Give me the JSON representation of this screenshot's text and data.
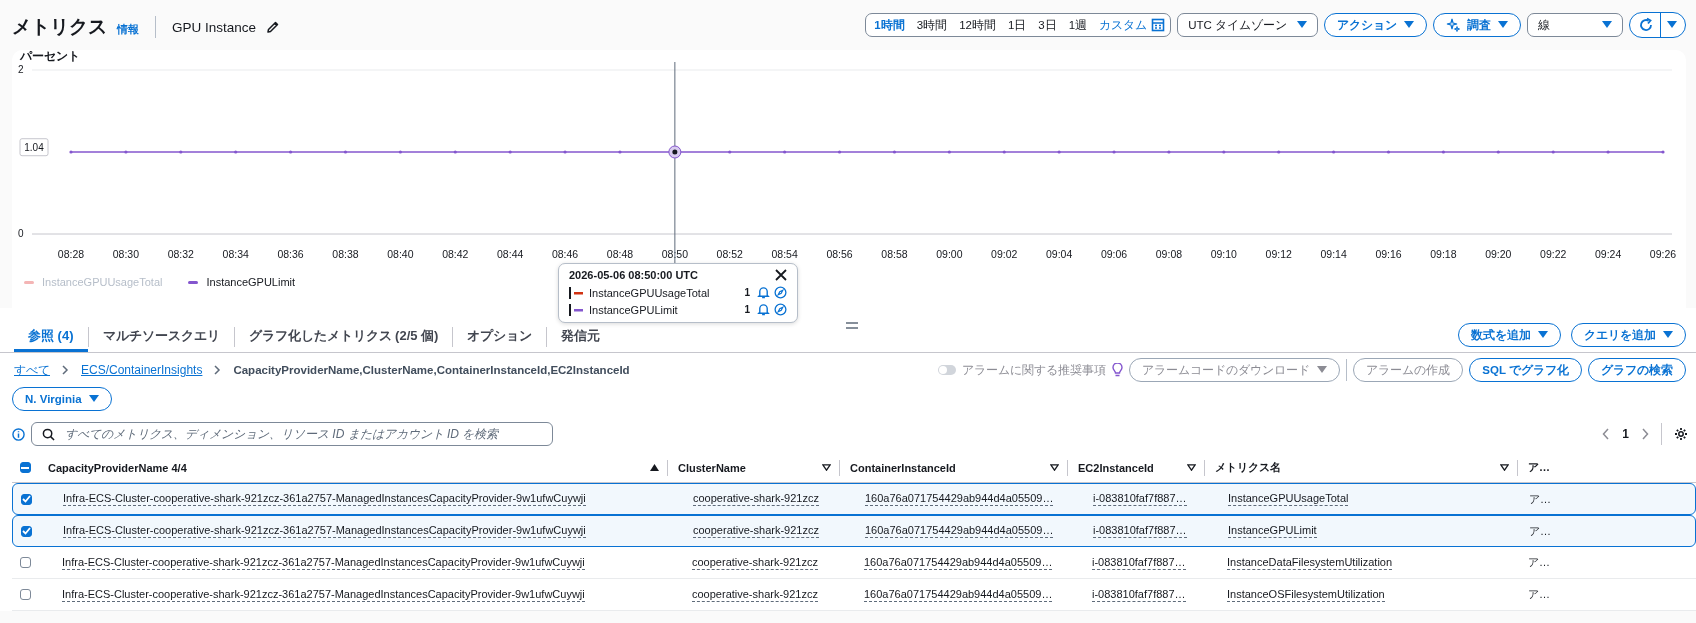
{
  "header": {
    "title": "メトリクス",
    "info_link": "情報",
    "graph_name": "GPU Instance"
  },
  "time_range": {
    "options": [
      {
        "label": "1時間",
        "selected": true
      },
      {
        "label": "3時間",
        "selected": false
      },
      {
        "label": "12時間",
        "selected": false
      },
      {
        "label": "1日",
        "selected": false
      },
      {
        "label": "3日",
        "selected": false
      },
      {
        "label": "1週",
        "selected": false
      }
    ],
    "custom": "カスタム"
  },
  "timezone": "UTC タイムゾーン",
  "actions": "アクション",
  "investigate": "調査",
  "chart_style": "線",
  "chart": {
    "ylabel": "パーセント",
    "cursor_value": "1.04",
    "chart_data": {
      "type": "line",
      "ylim": [
        0,
        2
      ],
      "yticks": [
        0,
        2
      ],
      "categories": [
        "08:28",
        "08:30",
        "08:32",
        "08:34",
        "08:36",
        "08:38",
        "08:40",
        "08:42",
        "08:44",
        "08:46",
        "08:48",
        "08:50",
        "08:52",
        "08:54",
        "08:56",
        "08:58",
        "09:00",
        "09:02",
        "09:04",
        "09:06",
        "09:08",
        "09:10",
        "09:12",
        "09:14",
        "09:16",
        "09:18",
        "09:20",
        "09:22",
        "09:24",
        "09:26"
      ],
      "series": [
        {
          "name": "InstanceGPULimit",
          "color": "#8456ce",
          "values": [
            1,
            1,
            1,
            1,
            1,
            1,
            1,
            1,
            1,
            1,
            1,
            1,
            1,
            1,
            1,
            1,
            1,
            1,
            1,
            1,
            1,
            1,
            1,
            1,
            1,
            1,
            1,
            1,
            1,
            1
          ]
        }
      ]
    },
    "hidden_series": [
      {
        "name": "InstanceGPUUsageTotal",
        "color": "#f4b5b5"
      }
    ]
  },
  "tooltip": {
    "time": "2026-05-06 08:50:00 UTC",
    "rows": [
      {
        "name": "InstanceGPUUsageTotal",
        "value": "1",
        "color": "#d13212"
      },
      {
        "name": "InstanceGPULimit",
        "value": "1",
        "color": "#8456ce"
      }
    ]
  },
  "tabs": [
    {
      "label": "参照 (4)",
      "selected": true
    },
    {
      "label": "マルチソースクエリ",
      "selected": false
    },
    {
      "label": "グラフ化したメトリクス (2/5 個)",
      "selected": false
    },
    {
      "label": "オプション",
      "selected": false
    },
    {
      "label": "発信元",
      "selected": false
    }
  ],
  "tab_actions": [
    "数式を追加",
    "クエリを追加"
  ],
  "breadcrumb": [
    {
      "label": "すべて",
      "link": true
    },
    {
      "label": "ECS/ContainerInsights",
      "link": true
    },
    {
      "label": "CapacityProviderName,ClusterName,ContainerInstanceId,EC2InstanceId",
      "link": false
    }
  ],
  "alarm_recommendations": {
    "label": "アラームに関する推奨事項",
    "on": false
  },
  "toolbar_buttons": [
    {
      "label": "アラームコードのダウンロード",
      "disabled": true,
      "dropdown": true
    },
    {
      "label": "アラームの作成",
      "disabled": true,
      "dropdown": false
    },
    {
      "label": "SQL でグラフ化",
      "disabled": false,
      "dropdown": false
    },
    {
      "label": "グラフの検索",
      "disabled": false,
      "dropdown": false
    }
  ],
  "region": "N. Virginia",
  "search": {
    "placeholder": "すべてのメトリクス、ディメンション、リソース ID またはアカウント ID を検索"
  },
  "pagination": {
    "page": "1"
  },
  "table": {
    "select_all": {
      "indeterminate": true
    },
    "columns": [
      {
        "label": "CapacityProviderName 4/4",
        "sorted": true
      },
      {
        "label": "ClusterName",
        "sorted": false
      },
      {
        "label": "ContainerInstanceId",
        "sorted": false
      },
      {
        "label": "EC2InstanceId",
        "sorted": false
      },
      {
        "label": "メトリクス名",
        "sorted": false
      },
      {
        "label": "ア…"
      }
    ],
    "rows": [
      {
        "selected": true,
        "cells": [
          "Infra-ECS-Cluster-cooperative-shark-921zcz-361a2757-ManagedInstancesCapacityProvider-9w1ufwCuywji",
          "cooperative-shark-921zcz",
          "160a76a071754429ab944d4a05509…",
          "i-083810faf7f887…",
          "InstanceGPUUsageTotal",
          "ア…"
        ]
      },
      {
        "selected": true,
        "cells": [
          "Infra-ECS-Cluster-cooperative-shark-921zcz-361a2757-ManagedInstancesCapacityProvider-9w1ufwCuywji",
          "cooperative-shark-921zcz",
          "160a76a071754429ab944d4a05509…",
          "i-083810faf7f887…",
          "InstanceGPULimit",
          "ア…"
        ]
      },
      {
        "selected": false,
        "cells": [
          "Infra-ECS-Cluster-cooperative-shark-921zcz-361a2757-ManagedInstancesCapacityProvider-9w1ufwCuywji",
          "cooperative-shark-921zcz",
          "160a76a071754429ab944d4a05509…",
          "i-083810faf7f887…",
          "InstanceDataFilesystemUtilization",
          "ア…"
        ]
      },
      {
        "selected": false,
        "cells": [
          "Infra-ECS-Cluster-cooperative-shark-921zcz-361a2757-ManagedInstancesCapacityProvider-9w1ufwCuywji",
          "cooperative-shark-921zcz",
          "160a76a071754429ab944d4a05509…",
          "i-083810faf7f887…",
          "InstanceOSFilesystemUtilization",
          "ア…"
        ]
      }
    ]
  }
}
